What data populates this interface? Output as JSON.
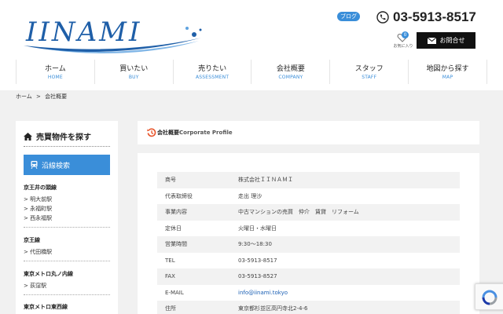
{
  "header": {
    "logo_text": "IINAMI",
    "blog_label": "ブログ",
    "phone_number": "03-5913-8517",
    "favorites_label": "お気に入り",
    "favorites_count": "0",
    "contact_label": "お問合せ"
  },
  "nav": [
    {
      "ja": "ホーム",
      "en": "HOME"
    },
    {
      "ja": "買いたい",
      "en": "BUY"
    },
    {
      "ja": "売りたい",
      "en": "ASSESSMENT"
    },
    {
      "ja": "会社概要",
      "en": "COMPANY"
    },
    {
      "ja": "スタッフ",
      "en": "STAFF"
    },
    {
      "ja": "地図から探す",
      "en": "MAP"
    }
  ],
  "breadcrumb": {
    "home": "ホーム",
    "sep": ">",
    "current": "会社概要"
  },
  "sidebar": {
    "title": "売買物件を探す",
    "route_button": "沿線検索",
    "lines": [
      {
        "name": "京王井の頭線",
        "stations": [
          "> 明大前駅",
          "> 永福町駅",
          "> 西永福駅"
        ]
      },
      {
        "name": "京王線",
        "stations": [
          "> 代田橋駅"
        ]
      },
      {
        "name": "東京メトロ丸ノ内線",
        "stations": [
          "> 荻窪駅"
        ]
      },
      {
        "name": "東京メトロ東西線",
        "stations": []
      }
    ]
  },
  "profile": {
    "heading_ja": "会社概要",
    "heading_en": "Corporate Profile",
    "rows": [
      {
        "label": "商号",
        "value": "株式会社ＩＩＮＡＭＩ"
      },
      {
        "label": "代表取締役",
        "value": "走出 理沙"
      },
      {
        "label": "事業内容",
        "value": "中古マンションの売買　仲介　賃貸　リフォーム"
      },
      {
        "label": "定休日",
        "value": "火曜日・水曜日"
      },
      {
        "label": "営業時間",
        "value": "9:30～18:30"
      },
      {
        "label": "TEL",
        "value": "03-5913-8517"
      },
      {
        "label": "FAX",
        "value": "03-5913-8527"
      },
      {
        "label": "E-MAIL",
        "value": "info@iinami.tokyo"
      },
      {
        "label": "住所",
        "value": "東京都杉並区高円寺北2-4-6"
      }
    ]
  },
  "colors": {
    "accent": "#3a8ed9",
    "logo_blue": "#1f5fa8",
    "dark_button": "#111111",
    "heading_icon": "#e8542a"
  },
  "icons": {
    "phone": "phone-icon",
    "favorite": "heart-icon",
    "contact": "envelope-icon",
    "sidebar": "house-icon",
    "route": "train-icon",
    "heading": "history-icon",
    "recaptcha": "recaptcha-icon"
  }
}
